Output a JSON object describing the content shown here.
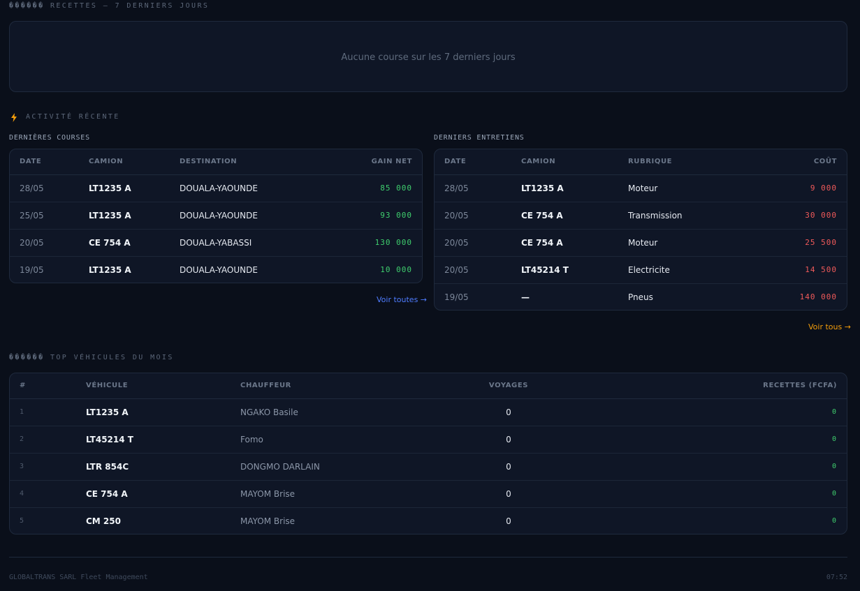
{
  "revenue": {
    "title": "������ RECETTES — 7 DERNIERS JOURS",
    "empty_message": "Aucune course sur les 7 derniers jours"
  },
  "activity": {
    "icon": "lightning-icon",
    "title": "ACTIVITÉ RÉCENTE",
    "trips": {
      "title": "DERNIÈRES COURSES",
      "headers": {
        "date": "DATE",
        "truck": "CAMION",
        "destination": "DESTINATION",
        "net": "GAIN NET"
      },
      "rows": [
        {
          "date": "28/05",
          "truck": "LT1235 A",
          "destination": "DOUALA-YAOUNDE",
          "net": "85 000"
        },
        {
          "date": "25/05",
          "truck": "LT1235 A",
          "destination": "DOUALA-YAOUNDE",
          "net": "93 000"
        },
        {
          "date": "20/05",
          "truck": "CE 754 A",
          "destination": "DOUALA-YABASSI",
          "net": "130 000"
        },
        {
          "date": "19/05",
          "truck": "LT1235 A",
          "destination": "DOUALA-YAOUNDE",
          "net": "10 000"
        }
      ],
      "link": "Voir toutes →"
    },
    "maintenance": {
      "title": "DERNIERS ENTRETIENS",
      "headers": {
        "date": "DATE",
        "truck": "CAMION",
        "category": "RUBRIQUE",
        "cost": "COÛT"
      },
      "rows": [
        {
          "date": "28/05",
          "truck": "LT1235 A",
          "category": "Moteur",
          "cost": "9 000"
        },
        {
          "date": "20/05",
          "truck": "CE 754 A",
          "category": "Transmission",
          "cost": "30 000"
        },
        {
          "date": "20/05",
          "truck": "CE 754 A",
          "category": "Moteur",
          "cost": "25 500"
        },
        {
          "date": "20/05",
          "truck": "LT45214 T",
          "category": "Electricite",
          "cost": "14 500"
        },
        {
          "date": "19/05",
          "truck": "—",
          "category": "Pneus",
          "cost": "140 000"
        }
      ],
      "link": "Voir tous →"
    }
  },
  "top": {
    "title": "������ TOP VÉHICULES DU MOIS",
    "headers": {
      "rank": "#",
      "vehicle": "VÉHICULE",
      "driver": "CHAUFFEUR",
      "trips": "VOYAGES",
      "revenue": "RECETTES (FCFA)"
    },
    "rows": [
      {
        "rank": "1",
        "vehicle": "LT1235 A",
        "driver": "NGAKO Basile",
        "trips": "0",
        "revenue": "0"
      },
      {
        "rank": "2",
        "vehicle": "LT45214 T",
        "driver": "Fomo",
        "trips": "0",
        "revenue": "0"
      },
      {
        "rank": "3",
        "vehicle": "LTR 854C",
        "driver": "DONGMO DARLAIN",
        "trips": "0",
        "revenue": "0"
      },
      {
        "rank": "4",
        "vehicle": "CE 754 A",
        "driver": "MAYOM Brise",
        "trips": "0",
        "revenue": "0"
      },
      {
        "rank": "5",
        "vehicle": "CM 250",
        "driver": "MAYOM Brise",
        "trips": "0",
        "revenue": "0"
      }
    ]
  },
  "footer": {
    "brand": "GLOBALTRANS SARL Fleet Management",
    "time": "07:52"
  },
  "colors": {
    "background": "#0a0f1a",
    "card": "#0f1626",
    "accent_orange": "#f59e0b",
    "link_blue": "#4f7cff",
    "positive_green": "#3fcf6e",
    "negative_red": "#f05a5a"
  }
}
